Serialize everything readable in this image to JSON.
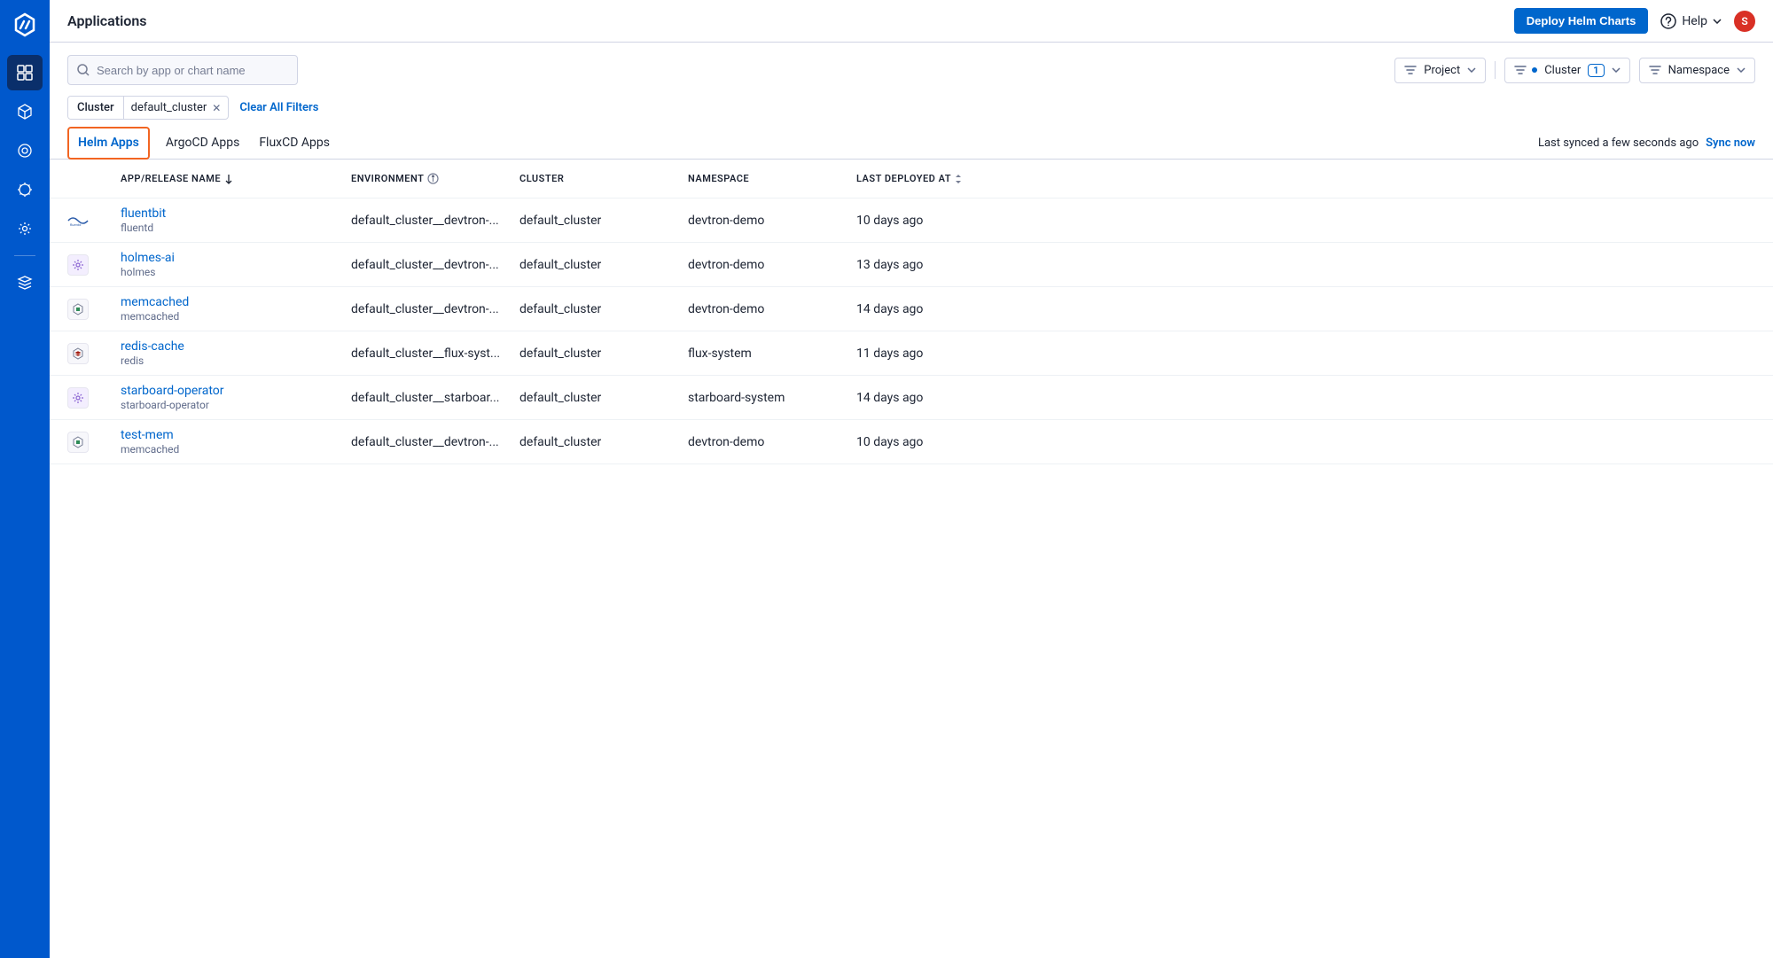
{
  "header": {
    "title": "Applications",
    "deploy_btn": "Deploy Helm Charts",
    "help": "Help",
    "avatar_initial": "S"
  },
  "search": {
    "placeholder": "Search by app or chart name"
  },
  "filters": {
    "project": "Project",
    "cluster": "Cluster",
    "cluster_count": "1",
    "namespace": "Namespace"
  },
  "chip": {
    "label": "Cluster",
    "value": "default_cluster"
  },
  "clear_filters": "Clear All Filters",
  "tabs": {
    "helm": "Helm Apps",
    "argocd": "ArgoCD Apps",
    "fluxcd": "FluxCD Apps"
  },
  "sync": {
    "text": "Last synced a few seconds ago",
    "action": "Sync now"
  },
  "columns": {
    "name": "APP/RELEASE NAME",
    "environment": "ENVIRONMENT",
    "cluster": "CLUSTER",
    "namespace": "NAMESPACE",
    "deployed": "LAST DEPLOYED AT"
  },
  "rows": [
    {
      "name": "fluentbit",
      "sub": "fluentd",
      "env": "default_cluster__devtron-...",
      "cluster": "default_cluster",
      "ns": "devtron-demo",
      "deployed": "10 days ago",
      "icon": "fluentd"
    },
    {
      "name": "holmes-ai",
      "sub": "holmes",
      "env": "default_cluster__devtron-...",
      "cluster": "default_cluster",
      "ns": "devtron-demo",
      "deployed": "13 days ago",
      "icon": "gear-purple"
    },
    {
      "name": "memcached",
      "sub": "memcached",
      "env": "default_cluster__devtron-...",
      "cluster": "default_cluster",
      "ns": "devtron-demo",
      "deployed": "14 days ago",
      "icon": "db-green"
    },
    {
      "name": "redis-cache",
      "sub": "redis",
      "env": "default_cluster__flux-syst...",
      "cluster": "default_cluster",
      "ns": "flux-system",
      "deployed": "11 days ago",
      "icon": "redis"
    },
    {
      "name": "starboard-operator",
      "sub": "starboard-operator",
      "env": "default_cluster__starboar...",
      "cluster": "default_cluster",
      "ns": "starboard-system",
      "deployed": "14 days ago",
      "icon": "gear-purple"
    },
    {
      "name": "test-mem",
      "sub": "memcached",
      "env": "default_cluster__devtron-...",
      "cluster": "default_cluster",
      "ns": "devtron-demo",
      "deployed": "10 days ago",
      "icon": "db-green"
    }
  ]
}
